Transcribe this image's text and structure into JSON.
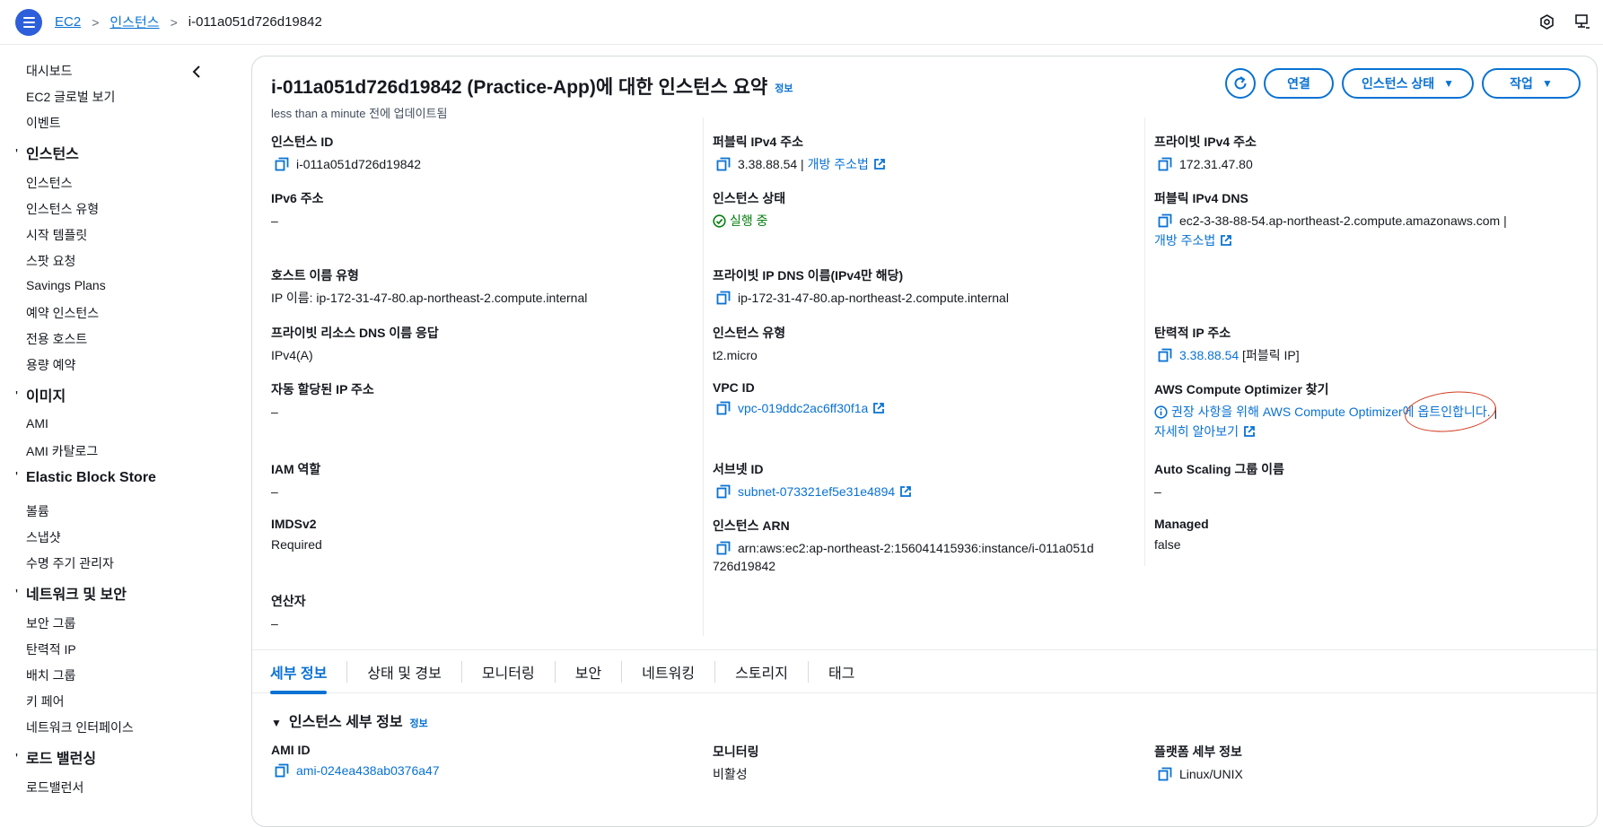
{
  "breadcrumb": {
    "home": "EC2",
    "section": "인스턴스",
    "current": "i-011a051d726d19842"
  },
  "sidebar": {
    "top_items": [
      "대시보드",
      "EC2 글로벌 보기",
      "이벤트"
    ],
    "groups": [
      {
        "title": "인스턴스",
        "items": [
          "인스턴스",
          "인스턴스 유형",
          "시작 템플릿",
          "스팟 요청",
          "Savings Plans",
          "예약 인스턴스",
          "전용 호스트",
          "용량 예약"
        ]
      },
      {
        "title": "이미지",
        "items": [
          "AMI",
          "AMI 카탈로그"
        ]
      },
      {
        "title": "Elastic Block Store",
        "items": [
          "볼륨",
          "스냅샷",
          "수명 주기 관리자"
        ]
      },
      {
        "title": "네트워크 및 보안",
        "items": [
          "보안 그룹",
          "탄력적 IP",
          "배치 그룹",
          "키 페어",
          "네트워크 인터페이스"
        ]
      },
      {
        "title": "로드 밸런싱",
        "items": [
          "로드밸런서"
        ]
      }
    ]
  },
  "summary": {
    "title": "i-011a051d726d19842 (Practice-App)에 대한 인스턴스 요약",
    "info": "정보",
    "updated": "less than a minute 전에 업데이트됨"
  },
  "actions": {
    "connect": "연결",
    "state": "인스턴스 상태",
    "actions": "작업"
  },
  "fields": {
    "instance_id": {
      "label": "인스턴스 ID",
      "value": "i-011a051d726d19842"
    },
    "public_ipv4": {
      "label": "퍼블릭 IPv4 주소",
      "value": "3.38.88.54",
      "sep": " | ",
      "link": "개방 주소법"
    },
    "private_ipv4": {
      "label": "프라이빗 IPv4 주소",
      "value": "172.31.47.80"
    },
    "ipv6": {
      "label": "IPv6 주소",
      "value": "–"
    },
    "instance_state": {
      "label": "인스턴스 상태",
      "value": "실행 중"
    },
    "public_dns": {
      "label": "퍼블릭 IPv4 DNS",
      "value": "ec2-3-38-88-54.ap-northeast-2.compute.amazonaws.com",
      "sep": " |",
      "link": "개방 주소법"
    },
    "hostname_type": {
      "label": "호스트 이름 유형",
      "value": "IP 이름: ip-172-31-47-80.ap-northeast-2.compute.internal"
    },
    "private_dns": {
      "label": "프라이빗 IP DNS 이름(IPv4만 해당)",
      "value": "ip-172-31-47-80.ap-northeast-2.compute.internal"
    },
    "private_dns_answer": {
      "label": "프라이빗 리소스 DNS 이름 응답",
      "value": "IPv4(A)"
    },
    "instance_type": {
      "label": "인스턴스 유형",
      "value": "t2.micro"
    },
    "elastic_ip": {
      "label": "탄력적 IP 주소",
      "value": "3.38.88.54",
      "suffix": " [퍼블릭 IP]"
    },
    "auto_ip": {
      "label": "자동 할당된 IP 주소",
      "value": "–"
    },
    "vpc_id": {
      "label": "VPC ID",
      "value": "vpc-019ddc2ac6ff30f1a"
    },
    "optimizer": {
      "label": "AWS Compute Optimizer 찾기",
      "value": "권장 사항을 위해 AWS Compute Optimizer에 옵트인합니다.",
      "sep": " |",
      "link": "자세히 알아보기"
    },
    "iam_role": {
      "label": "IAM 역할",
      "value": "–"
    },
    "subnet_id": {
      "label": "서브넷 ID",
      "value": "subnet-073321ef5e31e4894"
    },
    "asg_name": {
      "label": "Auto Scaling 그룹 이름",
      "value": "–"
    },
    "imdsv2": {
      "label": "IMDSv2",
      "value": "Required"
    },
    "instance_arn": {
      "label": "인스턴스 ARN",
      "value_line1": "arn:aws:ec2:ap-northeast-2:156041415936:instance/i-011a051d",
      "value_line2": "726d19842"
    },
    "managed": {
      "label": "Managed",
      "value": "false"
    },
    "operator": {
      "label": "연산자",
      "value": "–"
    }
  },
  "tabs": [
    "세부 정보",
    "상태 및 경보",
    "모니터링",
    "보안",
    "네트워킹",
    "스토리지",
    "태그"
  ],
  "details": {
    "title": "인스턴스 세부 정보",
    "info": "정보",
    "ami_id": {
      "label": "AMI ID",
      "value": "ami-024ea438ab0376a47"
    },
    "monitoring": {
      "label": "모니터링",
      "value": "비활성"
    },
    "platform": {
      "label": "플랫폼 세부 정보",
      "value": "Linux/UNIX"
    }
  },
  "colors": {
    "link": "#0972d3",
    "accent": "#2c5fd9",
    "success": "#037f0c",
    "annotation": "#d23b1f"
  }
}
